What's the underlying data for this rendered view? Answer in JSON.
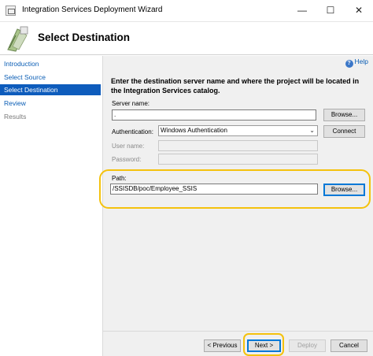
{
  "window": {
    "title": "Integration Services Deployment Wizard",
    "controls": {
      "minimize": "—",
      "maximize": "☐",
      "close": "✕"
    }
  },
  "header": {
    "title": "Select Destination",
    "icon": "wizard-icon"
  },
  "sidebar": {
    "items": [
      {
        "label": "Introduction",
        "state": "link"
      },
      {
        "label": "Select Source",
        "state": "link"
      },
      {
        "label": "Select Destination",
        "state": "active"
      },
      {
        "label": "Review",
        "state": "link"
      },
      {
        "label": "Results",
        "state": "disabled"
      }
    ]
  },
  "help": {
    "label": "Help",
    "icon": "help-icon"
  },
  "main": {
    "instructions": "Enter the destination server name and where the project will be located in the Integration Services catalog.",
    "server_name": {
      "label": "Server name:",
      "value": ".",
      "browse": "Browse..."
    },
    "authentication": {
      "label": "Authentication:",
      "value": "Windows Authentication",
      "connect": "Connect"
    },
    "user_name": {
      "label": "User name:",
      "value": ""
    },
    "password": {
      "label": "Password:",
      "value": ""
    },
    "path": {
      "label": "Path:",
      "value": "/SSISDB/poc/Employee_SSIS",
      "browse": "Browse..."
    }
  },
  "footer": {
    "previous": "< Previous",
    "next": "Next >",
    "deploy": "Deploy",
    "cancel": "Cancel"
  },
  "colors": {
    "highlight": "#f4c20d",
    "active_nav": "#0e5cbc",
    "link": "#0b5eb5"
  }
}
